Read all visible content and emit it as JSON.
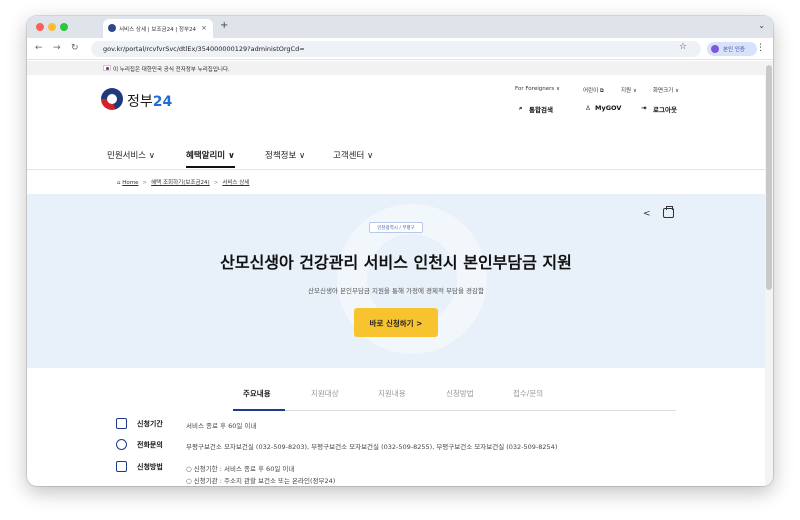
{
  "browser": {
    "tab_title": "서비스 상세 | 보조금24 | 정부24",
    "tab_close": "×",
    "new_tab": "+",
    "url": "gov.kr/portal/rcvfvrSvc/dtlEx/354000000129?administOrgCd=",
    "auth_label": "본인 인증",
    "colors": {
      "close": "#ff5f57",
      "minimize": "#febc2e",
      "maximize": "#28c840"
    }
  },
  "banner": {
    "text": "이 누리집은 대한민국 공식 전자정부 누리집입니다."
  },
  "header": {
    "logo_prefix": "정부",
    "logo_suffix": "24",
    "util_links": [
      "For Foreigners ∨",
      "어린이 ⧉",
      "지원 ∨",
      "화면크기 ∨"
    ],
    "search_label": "통합검색",
    "mygov_label": "MyGOV",
    "logout_label": "로그아웃"
  },
  "gnb": [
    {
      "label": "민원서비스 ∨"
    },
    {
      "label": "혜택알리미 ∨"
    },
    {
      "label": "정책정보 ∨"
    },
    {
      "label": "고객센터 ∨"
    }
  ],
  "breadcrumb": {
    "home": "Home",
    "level1": "혜택 조회하기(보조금24)",
    "level2": "서비스 상세",
    "sep": ">"
  },
  "hero": {
    "region_badge": "인천광역시 / 부평구",
    "title": "산모신생아 건강관리 서비스 인천시 본인부담금 지원",
    "subtitle": "산모신생아 본인부담금 지원을 통해 가정에 경제적 부담을 경감함",
    "apply_label": "바로 신청하기 >"
  },
  "content_tabs": [
    "주요내용",
    "지원대상",
    "지원내용",
    "신청방법",
    "접수/문의"
  ],
  "info": [
    {
      "label": "신청기간",
      "value": "서비스 종료 후 60일 이내",
      "icon": "calendar-icon"
    },
    {
      "label": "전화문의",
      "value": "부평구보건소 모자보건실 (032-509-8203), 부평구보건소 모자보건실 (032-509-8255), 부평구보건소 모자보건실 (032-509-8254)",
      "icon": "phone-icon"
    },
    {
      "label": "신청방법",
      "value": "○ 신청기한 : 서비스 종료 후 60일 이내",
      "value2": "○ 신청기관 : 주소지 관할 보건소 또는 온라인(정부24)",
      "icon": "document-icon"
    }
  ]
}
